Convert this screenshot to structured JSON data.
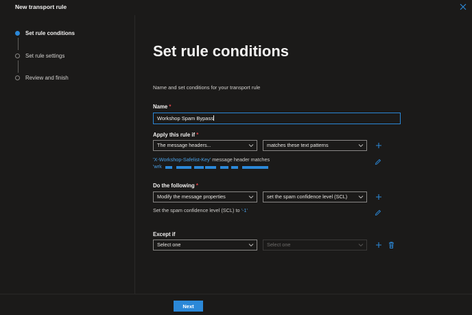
{
  "window": {
    "title": "New transport rule"
  },
  "steps": [
    {
      "label": "Set rule conditions",
      "active": true
    },
    {
      "label": "Set rule settings",
      "active": false
    },
    {
      "label": "Review and finish",
      "active": false
    }
  ],
  "main": {
    "heading": "Set rule conditions",
    "subtitle": "Name and set conditions for your transport rule",
    "name": {
      "label": "Name",
      "required_mark": "*",
      "value": "Workshop Spam Bypass"
    },
    "apply": {
      "label": "Apply this rule if",
      "required_mark": "*",
      "select1": "The message headers...",
      "select2": "matches these text patterns",
      "desc_link": "'X-Workshop-Safelist-Key'",
      "desc_text": "message header matches",
      "desc_line2_prefix": "'wrk"
    },
    "do": {
      "label": "Do the following",
      "required_mark": "*",
      "select1": "Modify the message properties",
      "select2": "set the spam confidence level (SCL)",
      "desc_text": "Set the spam confidence level (SCL) to",
      "desc_value": "'-1'"
    },
    "except": {
      "label": "Except if",
      "select1": "Select one",
      "select2_placeholder": "Select one"
    }
  },
  "footer": {
    "next_label": "Next"
  },
  "colors": {
    "accent": "#2b88d8",
    "link": "#4aa0e6",
    "required": "#e0454b",
    "background": "#1b1a19"
  },
  "icons": [
    "close-icon",
    "chevron-down-icon",
    "plus-icon",
    "edit-icon",
    "trash-icon"
  ]
}
